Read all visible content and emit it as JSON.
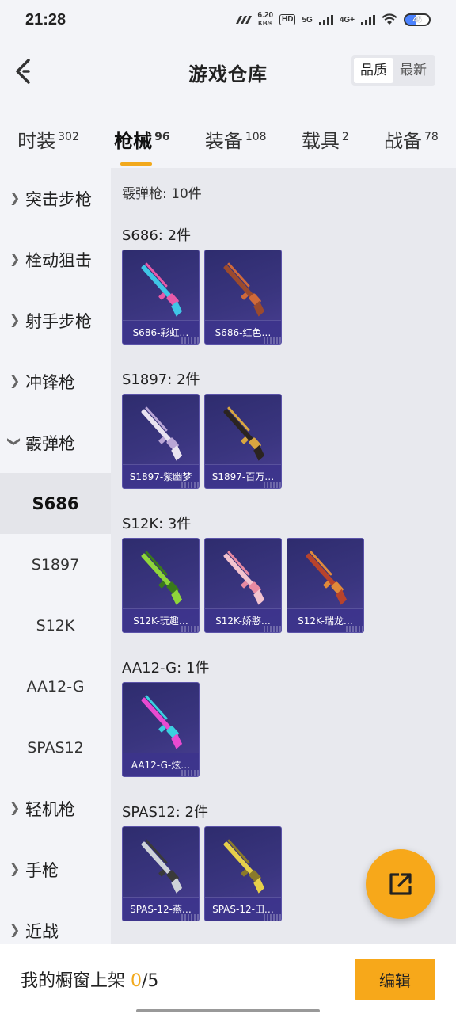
{
  "status_bar": {
    "time": "21:28",
    "net_speed_value": "6.20",
    "net_speed_unit": "KB/s",
    "hd": "HD",
    "net_5g": "5G",
    "net_4g": "4G+",
    "battery": "45"
  },
  "header": {
    "title": "游戏仓库",
    "sort_quality": "品质",
    "sort_newest": "最新"
  },
  "tabs": [
    {
      "label": "时装",
      "count": "302"
    },
    {
      "label": "枪械",
      "count": "96"
    },
    {
      "label": "装备",
      "count": "108"
    },
    {
      "label": "载具",
      "count": "2"
    },
    {
      "label": "战备",
      "count": "78"
    }
  ],
  "sidebar": {
    "items": [
      {
        "label": "突击步枪",
        "type": "category"
      },
      {
        "label": "栓动狙击",
        "type": "category"
      },
      {
        "label": "射手步枪",
        "type": "category"
      },
      {
        "label": "冲锋枪",
        "type": "category"
      },
      {
        "label": "霰弹枪",
        "type": "category-open"
      },
      {
        "label": "S686",
        "type": "sub-active"
      },
      {
        "label": "S1897",
        "type": "sub"
      },
      {
        "label": "S12K",
        "type": "sub"
      },
      {
        "label": "AA12-G",
        "type": "sub"
      },
      {
        "label": "SPAS12",
        "type": "sub"
      },
      {
        "label": "轻机枪",
        "type": "category"
      },
      {
        "label": "手枪",
        "type": "category"
      },
      {
        "label": "近战",
        "type": "category"
      }
    ]
  },
  "main": {
    "total": "霰弹枪: 10件",
    "groups": [
      {
        "title": "S686: 2件",
        "items": [
          {
            "name": "S686-彩虹…",
            "color": "#3fc6e6",
            "accent": "#e85aa8"
          },
          {
            "name": "S686-红色…",
            "color": "#9b4a2e",
            "accent": "#d06a3a"
          }
        ]
      },
      {
        "title": "S1897: 2件",
        "items": [
          {
            "name": "S1897-紫幽梦",
            "color": "#e9e3f0",
            "accent": "#b9a6d6"
          },
          {
            "name": "S1897-百万…",
            "color": "#2b2420",
            "accent": "#d9a640"
          }
        ]
      },
      {
        "title": "S12K: 3件",
        "items": [
          {
            "name": "S12K-玩趣…",
            "color": "#8fd63a",
            "accent": "#3a7a1a"
          },
          {
            "name": "S12K-娇憨…",
            "color": "#f3c3cf",
            "accent": "#e88aa2"
          },
          {
            "name": "S12K-瑞龙…",
            "color": "#b8432c",
            "accent": "#e08a3a"
          }
        ]
      },
      {
        "title": "AA12-G: 1件",
        "items": [
          {
            "name": "AA12-G-炫…",
            "color": "#e84ad0",
            "accent": "#3ad0e0"
          }
        ]
      },
      {
        "title": "SPAS12: 2件",
        "items": [
          {
            "name": "SPAS-12-燕…",
            "color": "#cfd3d8",
            "accent": "#3a3a3a"
          },
          {
            "name": "SPAS-12-田…",
            "color": "#e6d04a",
            "accent": "#8a7a2a"
          }
        ]
      }
    ]
  },
  "bottom": {
    "showcase_prefix": "我的橱窗上架 ",
    "showcase_count": "0",
    "showcase_total": "/5",
    "edit_label": "编辑"
  },
  "colors": {
    "accent": "#f7a81a",
    "card_bg": "#3a357f"
  }
}
